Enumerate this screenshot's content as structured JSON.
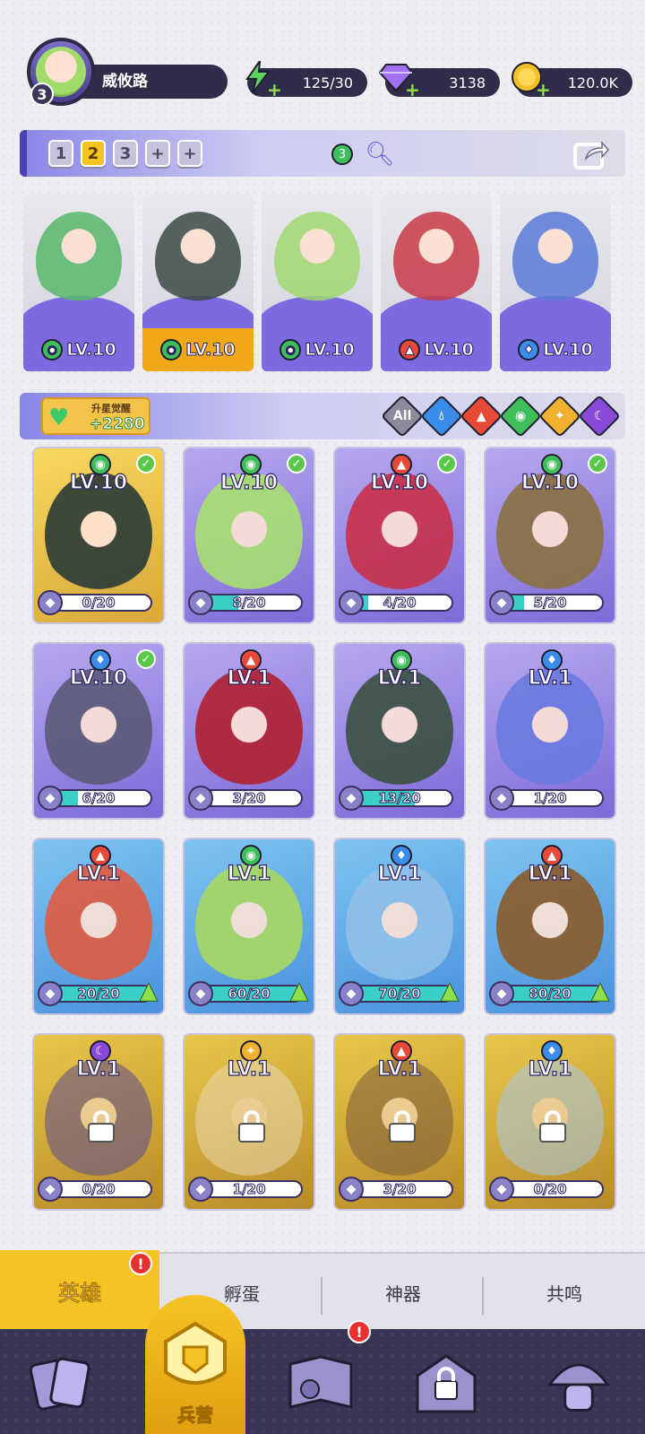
{
  "player": {
    "level": "3",
    "name": "威攸路"
  },
  "resources": {
    "energy": "125/30",
    "gems": "3138",
    "coins": "120.0K"
  },
  "team": {
    "slots": [
      "1",
      "2",
      "3",
      "+",
      "+"
    ],
    "active_slot": 1,
    "badge": "3"
  },
  "team_heroes": [
    {
      "level": "LV.10",
      "element": "green",
      "active": false
    },
    {
      "level": "LV.10",
      "element": "green",
      "active": true
    },
    {
      "level": "LV.10",
      "element": "green",
      "active": false
    },
    {
      "level": "LV.10",
      "element": "fire",
      "active": false
    },
    {
      "level": "LV.10",
      "element": "water",
      "active": false
    }
  ],
  "awaken": {
    "label": "升星觉醒",
    "value": "+2280"
  },
  "filters": [
    "All",
    "water",
    "fire",
    "green",
    "light",
    "dark"
  ],
  "heroes": [
    {
      "level": "LV.10",
      "element": "green",
      "progress": "0/20",
      "checked": true,
      "style": "yellow",
      "locked": false,
      "upgrade": false
    },
    {
      "level": "LV.10",
      "element": "green",
      "progress": "8/20",
      "checked": true,
      "style": "purple",
      "locked": false,
      "upgrade": false
    },
    {
      "level": "LV.10",
      "element": "fire",
      "progress": "4/20",
      "checked": true,
      "style": "purple",
      "locked": false,
      "upgrade": false
    },
    {
      "level": "LV.10",
      "element": "green",
      "progress": "5/20",
      "checked": true,
      "style": "purple",
      "locked": false,
      "upgrade": false
    },
    {
      "level": "LV.10",
      "element": "water",
      "progress": "6/20",
      "checked": true,
      "style": "purple",
      "locked": false,
      "upgrade": false
    },
    {
      "level": "LV.1",
      "element": "fire",
      "progress": "3/20",
      "checked": false,
      "style": "purple",
      "locked": false,
      "upgrade": false
    },
    {
      "level": "LV.1",
      "element": "green",
      "progress": "13/20",
      "checked": false,
      "style": "purple",
      "locked": false,
      "upgrade": false
    },
    {
      "level": "LV.1",
      "element": "water",
      "progress": "1/20",
      "checked": false,
      "style": "purple",
      "locked": false,
      "upgrade": false
    },
    {
      "level": "LV.1",
      "element": "fire",
      "progress": "20/20",
      "checked": false,
      "style": "blue",
      "locked": false,
      "upgrade": true
    },
    {
      "level": "LV.1",
      "element": "green",
      "progress": "60/20",
      "checked": false,
      "style": "blue",
      "locked": false,
      "upgrade": true
    },
    {
      "level": "LV.1",
      "element": "water",
      "progress": "70/20",
      "checked": false,
      "style": "blue",
      "locked": false,
      "upgrade": true
    },
    {
      "level": "LV.1",
      "element": "fire",
      "progress": "80/20",
      "checked": false,
      "style": "blue",
      "locked": false,
      "upgrade": true
    },
    {
      "level": "LV.1",
      "element": "dark",
      "progress": "0/20",
      "checked": false,
      "style": "gold",
      "locked": true,
      "upgrade": false
    },
    {
      "level": "LV.1",
      "element": "light",
      "progress": "1/20",
      "checked": false,
      "style": "gold",
      "locked": true,
      "upgrade": false
    },
    {
      "level": "LV.1",
      "element": "fire",
      "progress": "3/20",
      "checked": false,
      "style": "gold",
      "locked": true,
      "upgrade": false
    },
    {
      "level": "LV.1",
      "element": "water",
      "progress": "0/20",
      "checked": false,
      "style": "gold",
      "locked": true,
      "upgrade": false
    }
  ],
  "tabs": {
    "heroes": "英雄",
    "hatch": "孵蛋",
    "artifact": "神器",
    "resonance": "共鸣"
  },
  "badges": {
    "alert": "!"
  },
  "nav": {
    "barracks": "兵营"
  }
}
